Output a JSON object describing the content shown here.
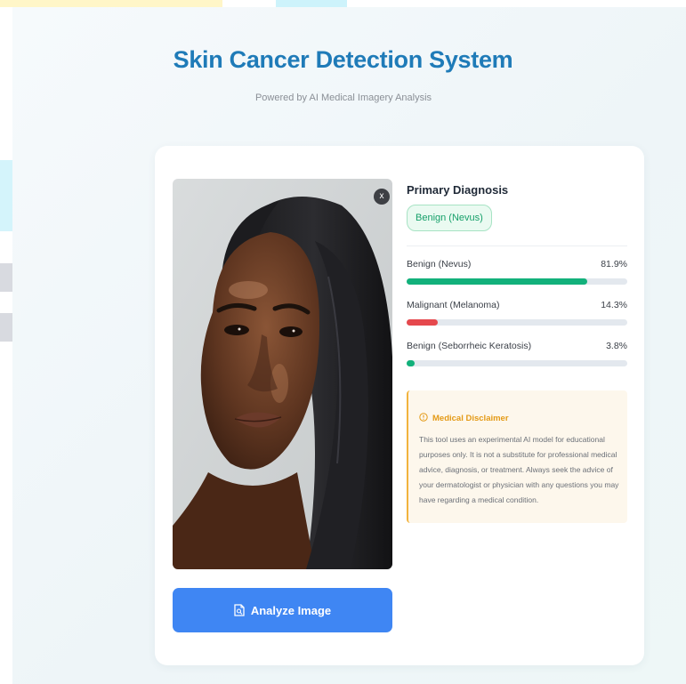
{
  "header": {
    "title": "Skin Cancer Detection System",
    "subtitle": "Powered by AI Medical Imagery Analysis"
  },
  "upload": {
    "remove_label": "x",
    "analyze_label": "Analyze Image",
    "analyze_icon": "file-scan-icon",
    "remove_icon": "close-icon"
  },
  "results": {
    "primary_heading": "Primary Diagnosis",
    "primary_label": "Benign (Nevus)",
    "predictions": [
      {
        "label": "Benign (Nevus)",
        "percent_text": "81.9%",
        "value": 81.9,
        "color": "#12b17b"
      },
      {
        "label": "Malignant (Melanoma)",
        "percent_text": "14.3%",
        "value": 14.3,
        "color": "#e5484d"
      },
      {
        "label": "Benign (Seborrheic Keratosis)",
        "percent_text": "3.8%",
        "value": 3.8,
        "color": "#12b17b"
      }
    ]
  },
  "disclaimer": {
    "icon": "warning-icon",
    "title": "Medical Disclaimer",
    "text": "This tool uses an experimental AI model for educational purposes only. It is not a substitute for professional medical advice, diagnosis, or treatment. Always seek the advice of your dermatologist or physician with any questions you may have regarding a medical condition."
  },
  "colors": {
    "accent": "#3f86f3",
    "title": "#1f7bb8",
    "success": "#12b17b",
    "danger": "#e5484d",
    "warning": "#f2b33d"
  }
}
